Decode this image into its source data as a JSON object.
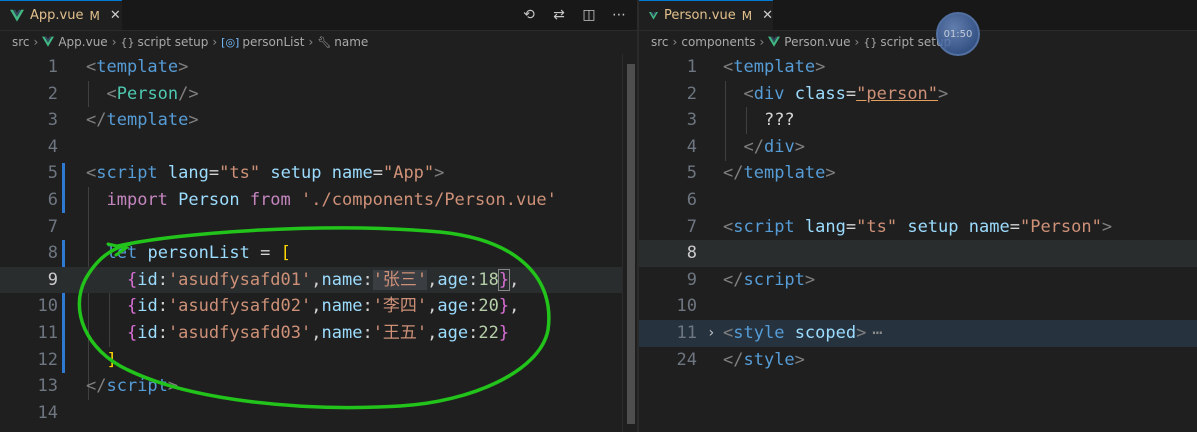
{
  "left": {
    "tab": {
      "name": "App.vue",
      "modified": "M",
      "close": "✕"
    },
    "breadcrumb": [
      "src",
      "App.vue",
      "script setup",
      "personList",
      "name"
    ],
    "line_numbers": [
      "1",
      "2",
      "3",
      "4",
      "5",
      "6",
      "7",
      "8",
      "9",
      "10",
      "11",
      "12",
      "13",
      "14"
    ],
    "code": {
      "l1": "template",
      "l2": "Person",
      "l3": "template",
      "l5_tag": "script",
      "l5_a1": "lang",
      "l5_v1": "\"ts\"",
      "l5_a2": "setup",
      "l5_a3": "name",
      "l5_v3": "\"App\"",
      "l6_kw": "import",
      "l6_id": "Person",
      "l6_from": "from",
      "l6_str": "'./components/Person.vue'",
      "l8_kw": "let",
      "l8_id": "personList",
      "rows": [
        {
          "id": "'asudfysafd01'",
          "name": "'张三'",
          "age": "18"
        },
        {
          "id": "'asudfysafd02'",
          "name": "'李四'",
          "age": "20"
        },
        {
          "id": "'asudfysafd03'",
          "name": "'王五'",
          "age": "22"
        }
      ],
      "l13": "script"
    }
  },
  "right": {
    "tab": {
      "name": "Person.vue",
      "modified": "M",
      "close": "✕"
    },
    "breadcrumb": [
      "src",
      "components",
      "Person.vue",
      "script setup"
    ],
    "line_numbers": [
      "1",
      "2",
      "3",
      "4",
      "5",
      "6",
      "7",
      "8",
      "9",
      "10",
      "11",
      "24"
    ],
    "code": {
      "l1": "template",
      "l2_tag": "div",
      "l2_attr": "class",
      "l2_val": "\"person\"",
      "l3": "???",
      "l4": "div",
      "l5": "template",
      "l7_tag": "script",
      "l7_a1": "lang",
      "l7_v1": "\"ts\"",
      "l7_a2": "setup",
      "l7_a3": "name",
      "l7_v3": "\"Person\"",
      "l9": "script",
      "l11_tag": "style",
      "l11_attr": "scoped",
      "l11_more": "⋯",
      "l24": "style"
    }
  },
  "overlay_clock": "01:50",
  "annotation_color": "#22c31a"
}
